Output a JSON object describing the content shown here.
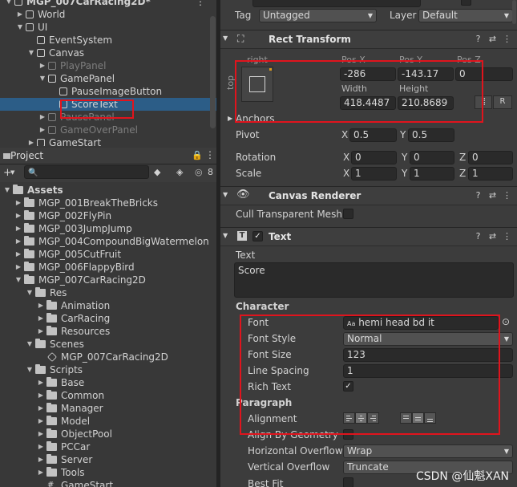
{
  "hierarchy": {
    "items": [
      {
        "label": "MGP_007CarRacing2D*",
        "depth": 0,
        "kind": "scene",
        "expanded": true
      },
      {
        "label": "World",
        "depth": 1,
        "kind": "go",
        "expanded": false
      },
      {
        "label": "UI",
        "depth": 1,
        "kind": "go",
        "expanded": true
      },
      {
        "label": "EventSystem",
        "depth": 2,
        "kind": "go"
      },
      {
        "label": "Canvas",
        "depth": 2,
        "kind": "go",
        "expanded": true
      },
      {
        "label": "PlayPanel",
        "depth": 3,
        "kind": "go",
        "expanded": false,
        "dim": true
      },
      {
        "label": "GamePanel",
        "depth": 3,
        "kind": "go",
        "expanded": true
      },
      {
        "label": "PauseImageButton",
        "depth": 4,
        "kind": "go"
      },
      {
        "label": "ScoreText",
        "depth": 4,
        "kind": "go",
        "selected": true
      },
      {
        "label": "PausePanel",
        "depth": 3,
        "kind": "go",
        "expanded": false,
        "dim": true
      },
      {
        "label": "GameOverPanel",
        "depth": 3,
        "kind": "go",
        "expanded": false,
        "dim": true
      },
      {
        "label": "GameStart",
        "depth": 2,
        "kind": "go",
        "expanded": false
      }
    ]
  },
  "project": {
    "tab_label": "Project",
    "lock_icon": "lock-icon",
    "hidden_count": "8",
    "root": "Assets",
    "tree": [
      {
        "label": "MGP_001BreakTheBricks",
        "depth": 1,
        "expanded": false
      },
      {
        "label": "MGP_002FlyPin",
        "depth": 1,
        "expanded": false
      },
      {
        "label": "MGP_003JumpJump",
        "depth": 1,
        "expanded": false
      },
      {
        "label": "MGP_004CompoundBigWatermelon",
        "depth": 1,
        "expanded": false
      },
      {
        "label": "MGP_005CutFruit",
        "depth": 1,
        "expanded": false
      },
      {
        "label": "MGP_006FlappyBird",
        "depth": 1,
        "expanded": false
      },
      {
        "label": "MGP_007CarRacing2D",
        "depth": 1,
        "expanded": true
      },
      {
        "label": "Res",
        "depth": 2,
        "expanded": true
      },
      {
        "label": "Animation",
        "depth": 3,
        "expanded": false
      },
      {
        "label": "CarRacing",
        "depth": 3,
        "expanded": false
      },
      {
        "label": "Resources",
        "depth": 3,
        "expanded": false
      },
      {
        "label": "Scenes",
        "depth": 2,
        "expanded": true
      },
      {
        "label": "MGP_007CarRacing2D",
        "depth": 3,
        "kind": "scene"
      },
      {
        "label": "Scripts",
        "depth": 2,
        "expanded": true
      },
      {
        "label": "Base",
        "depth": 3,
        "expanded": false
      },
      {
        "label": "Common",
        "depth": 3,
        "expanded": false
      },
      {
        "label": "Manager",
        "depth": 3,
        "expanded": false
      },
      {
        "label": "Model",
        "depth": 3,
        "expanded": false
      },
      {
        "label": "ObjectPool",
        "depth": 3,
        "expanded": false
      },
      {
        "label": "PCCar",
        "depth": 3,
        "expanded": false
      },
      {
        "label": "Server",
        "depth": 3,
        "expanded": false
      },
      {
        "label": "Tools",
        "depth": 3,
        "expanded": false
      },
      {
        "label": "GameStart",
        "depth": 3,
        "kind": "script"
      }
    ]
  },
  "inspector": {
    "tag_label": "Tag",
    "tag_value": "Untagged",
    "layer_label": "Layer",
    "layer_value": "Default",
    "rect_transform": {
      "title": "Rect Transform",
      "anchor_h": "right",
      "anchor_v": "top",
      "posx_label": "Pos X",
      "posx": "-286",
      "posy_label": "Pos Y",
      "posy": "-143.17",
      "posz_label": "Pos Z",
      "posz": "0",
      "width_label": "Width",
      "width": "418.4487",
      "height_label": "Height",
      "height": "210.8689",
      "r_button": "R",
      "anchors_label": "Anchors",
      "pivot_label": "Pivot",
      "pivot_x": "0.5",
      "pivot_y": "0.5",
      "rotation_label": "Rotation",
      "rot_x": "0",
      "rot_y": "0",
      "rot_z": "0",
      "scale_label": "Scale",
      "scale_x": "1",
      "scale_y": "1",
      "scale_z": "1",
      "x": "X",
      "y": "Y",
      "z": "Z"
    },
    "canvas_renderer": {
      "title": "Canvas Renderer",
      "cull_label": "Cull Transparent Mesh",
      "cull_checked": false
    },
    "text": {
      "title": "Text",
      "enabled": true,
      "text_label": "Text",
      "text_value": "Score",
      "character_label": "Character",
      "font_label": "Font",
      "font_prefix": "Aa",
      "font_value": "hemi head bd it",
      "font_style_label": "Font Style",
      "font_style_value": "Normal",
      "font_size_label": "Font Size",
      "font_size_value": "123",
      "line_spacing_label": "Line Spacing",
      "line_spacing_value": "1",
      "rich_text_label": "Rich Text",
      "rich_text_checked": true,
      "paragraph_label": "Paragraph",
      "alignment_label": "Alignment",
      "align_by_geometry_label": "Align By Geometry",
      "h_overflow_label": "Horizontal Overflow",
      "h_overflow_value": "Wrap",
      "v_overflow_label": "Vertical Overflow",
      "v_overflow_value": "Truncate",
      "best_fit_label": "Best Fit"
    }
  },
  "watermark": "CSDN @仙魁XAN",
  "colors": {
    "selection": "#2c5d87",
    "annotation": "#e0141d",
    "panel": "#383838",
    "field": "#2a2a2a"
  }
}
